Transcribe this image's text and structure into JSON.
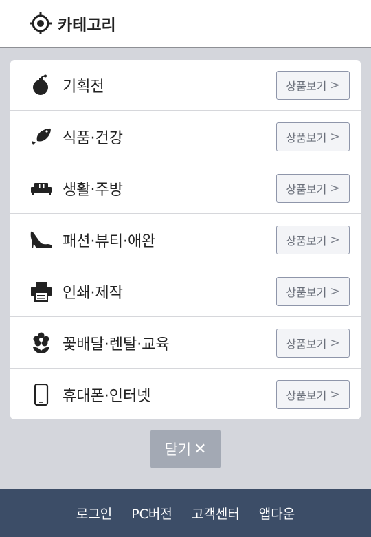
{
  "header": {
    "icon": "target-icon",
    "title": "카테고리"
  },
  "categories": [
    {
      "icon": "bomb-icon",
      "label": "기획전",
      "button": "상품보기"
    },
    {
      "icon": "fish-icon",
      "label": "식품·건강",
      "button": "상품보기"
    },
    {
      "icon": "sofa-icon",
      "label": "생활·주방",
      "button": "상품보기"
    },
    {
      "icon": "high-heel-icon",
      "label": "패션·뷰티·애완",
      "button": "상품보기"
    },
    {
      "icon": "printer-icon",
      "label": "인쇄·제작",
      "button": "상품보기"
    },
    {
      "icon": "flower-icon",
      "label": "꽃배달·렌탈·교육",
      "button": "상품보기"
    },
    {
      "icon": "mobile-phone-icon",
      "label": "휴대폰·인터넷",
      "button": "상품보기"
    }
  ],
  "close_button": {
    "label": "닫기",
    "icon": "close-icon"
  },
  "footer": {
    "links": [
      "로그인",
      "PC버전",
      "고객센터",
      "앱다운"
    ]
  },
  "colors": {
    "background": "#d4d6dc",
    "footer": "#3c4d67",
    "close_button": "#a3a9b4"
  }
}
